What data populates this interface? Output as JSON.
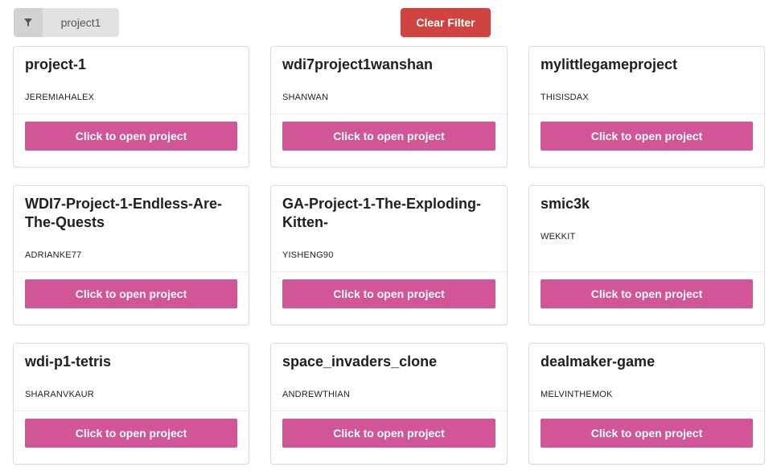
{
  "filter": {
    "icon": "filter-icon",
    "value": "project1"
  },
  "clear_filter": {
    "label": "Clear Filter",
    "color": "#d0443f"
  },
  "open_button_color": "#d15597",
  "projects": [
    {
      "title": "project-1",
      "owner": "JEREMIAHALEX",
      "button": "Click to open project"
    },
    {
      "title": "wdi7project1wanshan",
      "owner": "SHANWAN",
      "button": "Click to open project"
    },
    {
      "title": "mylittlegameproject",
      "owner": "THISISDAX",
      "button": "Click to open project"
    },
    {
      "title": "WDI7-Project-1-Endless-Are-The-Quests",
      "owner": "ADRIANKE77",
      "button": "Click to open project"
    },
    {
      "title": "GA-Project-1-The-Exploding-Kitten-",
      "owner": "YISHENG90",
      "button": "Click to open project"
    },
    {
      "title": "smic3k",
      "owner": "WEKKIT",
      "button": "Click to open project"
    },
    {
      "title": "wdi-p1-tetris",
      "owner": "SHARANVKAUR",
      "button": "Click to open project"
    },
    {
      "title": "space_invaders_clone",
      "owner": "ANDREWTHIAN",
      "button": "Click to open project"
    },
    {
      "title": "dealmaker-game",
      "owner": "MELVINTHEMOK",
      "button": "Click to open project"
    }
  ]
}
